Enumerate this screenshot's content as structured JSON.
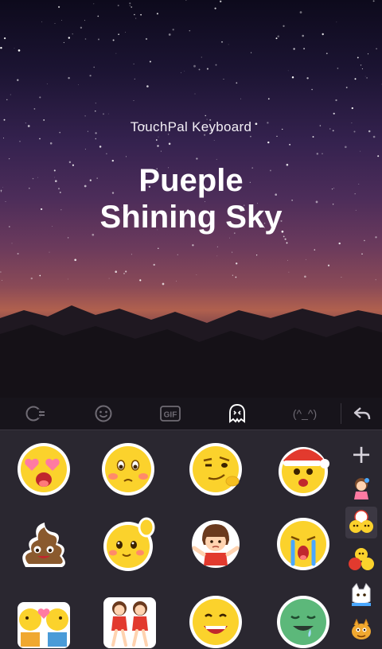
{
  "header": {
    "brand": "TouchPal Keyboard",
    "title_line1": "Pueple",
    "title_line2": "Shining Sky"
  },
  "toolbar": {
    "items": [
      {
        "icon": "emoji-category-icon"
      },
      {
        "icon": "smiley-icon"
      },
      {
        "icon": "gif-icon",
        "label": "GIF"
      },
      {
        "icon": "sticker-icon",
        "active": true
      },
      {
        "icon": "emoticon-icon",
        "label": "(^_^)"
      },
      {
        "icon": "back-arrow-icon"
      }
    ]
  },
  "stickers": [
    {
      "name": "heart-eyes-sticker"
    },
    {
      "name": "blushing-face-sticker"
    },
    {
      "name": "smirking-face-sticker"
    },
    {
      "name": "santa-face-sticker"
    },
    {
      "name": "poop-sticker"
    },
    {
      "name": "waving-face-sticker"
    },
    {
      "name": "girl-shrug-sticker"
    },
    {
      "name": "crying-face-sticker"
    },
    {
      "name": "kissing-pair-sticker"
    },
    {
      "name": "dancing-twins-sticker"
    },
    {
      "name": "grinning-face-sticker"
    },
    {
      "name": "green-drooling-face-sticker"
    }
  ],
  "sidebar": {
    "add_label": "+",
    "packs": [
      {
        "name": "girl-pack"
      },
      {
        "name": "emoji-faces-pack",
        "selected": true
      },
      {
        "name": "red-faces-pack"
      },
      {
        "name": "cat-pack"
      },
      {
        "name": "monster-pack"
      }
    ]
  },
  "colors": {
    "accent": "#ffffff",
    "toolbar_bg": "#17141b",
    "panel_bg": "#2a2730",
    "emoji_yellow": "#fbd22c"
  }
}
